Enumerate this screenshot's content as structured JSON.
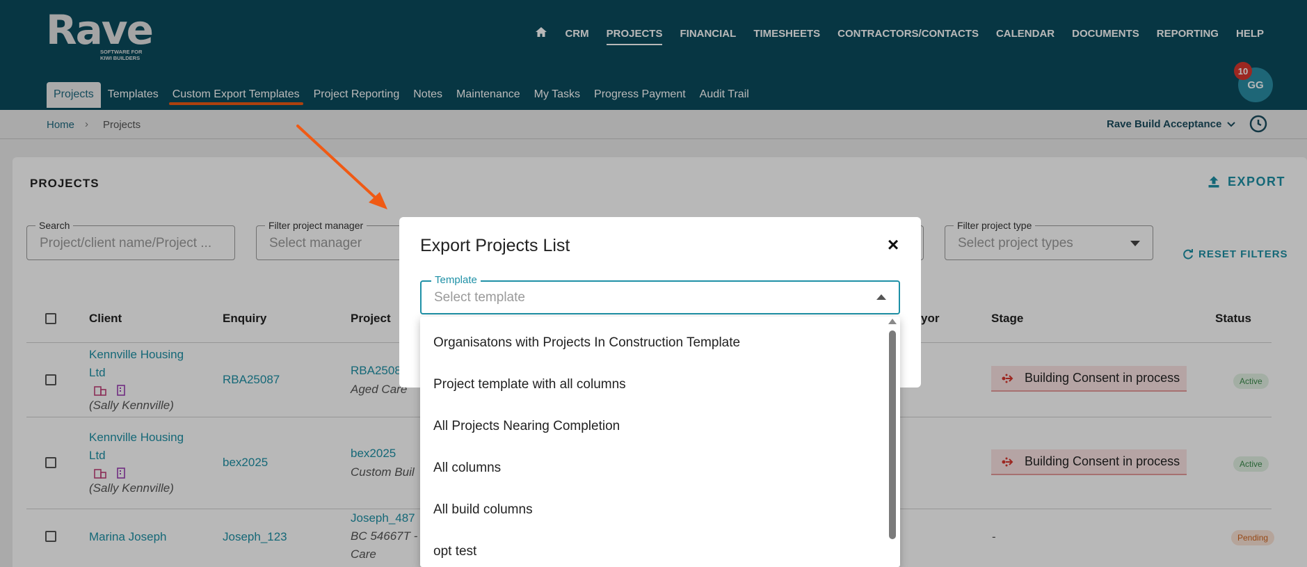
{
  "app": {
    "logo_text": "Rave",
    "logo_tagline": "SOFTWARE FOR KIWI BUILDERS"
  },
  "main_nav": [
    "CRM",
    "PROJECTS",
    "FINANCIAL",
    "TIMESHEETS",
    "CONTRACTORS/CONTACTS",
    "CALENDAR",
    "DOCUMENTS",
    "REPORTING",
    "HELP"
  ],
  "main_nav_active": "PROJECTS",
  "sub_nav": [
    "Projects",
    "Templates",
    "Custom Export Templates",
    "Project Reporting",
    "Notes",
    "Maintenance",
    "My Tasks",
    "Progress Payment",
    "Audit Trail"
  ],
  "sub_nav_active": "Projects",
  "sub_nav_highlighted": "Custom Export Templates",
  "user": {
    "initials": "GG",
    "notification_count": "10"
  },
  "breadcrumb": {
    "home": "Home",
    "separator": "›",
    "current": "Projects"
  },
  "organisation": "Rave Build Acceptance",
  "page": {
    "title": "PROJECTS",
    "export_label": "EXPORT",
    "reset_label": "RESET FILTERS"
  },
  "filters": {
    "search": {
      "label": "Search",
      "placeholder": "Project/client name/Project ..."
    },
    "manager": {
      "label": "Filter project manager",
      "placeholder": "Select manager"
    },
    "type": {
      "label": "Filter project type",
      "placeholder": "Select project types"
    }
  },
  "table": {
    "headers": {
      "client": "Client",
      "enquiry": "Enquiry",
      "project": "Project",
      "surveyor": "yor",
      "stage": "Stage",
      "status": "Status"
    },
    "rows": [
      {
        "client_line1": "Kennville Housing",
        "client_line2": "Ltd",
        "contact": "(Sally Kennville)",
        "enquiry": "RBA25087",
        "project": "RBA2508",
        "project_sub": "Aged Care",
        "stage": "Building Consent in process",
        "status": "Active"
      },
      {
        "client_line1": "Kennville Housing",
        "client_line2": "Ltd",
        "contact": "(Sally Kennville)",
        "enquiry": "bex2025",
        "project": "bex2025",
        "project_sub": "Custom Buil",
        "stage": "Building Consent in process",
        "status": "Active"
      },
      {
        "client_line1": "Marina Joseph",
        "enquiry": "Joseph_123",
        "project": "Joseph_487",
        "project_sub": "BC 54667T -",
        "project_sub2": "Care",
        "stage": "-",
        "status": "Pending"
      }
    ]
  },
  "modal": {
    "title": "Export Projects List",
    "close_label": "×",
    "template_label": "Template",
    "template_placeholder": "Select template",
    "options": [
      "Organisatons with Projects In Construction Template",
      "Project template with all columns",
      "All Projects Nearing Completion",
      "All columns",
      "All build columns",
      "opt test"
    ]
  },
  "colors": {
    "header_bg": "#0b4b5e",
    "accent": "#1e90a6",
    "annotation_orange": "#f05a14",
    "badge_red": "#d9372e"
  }
}
